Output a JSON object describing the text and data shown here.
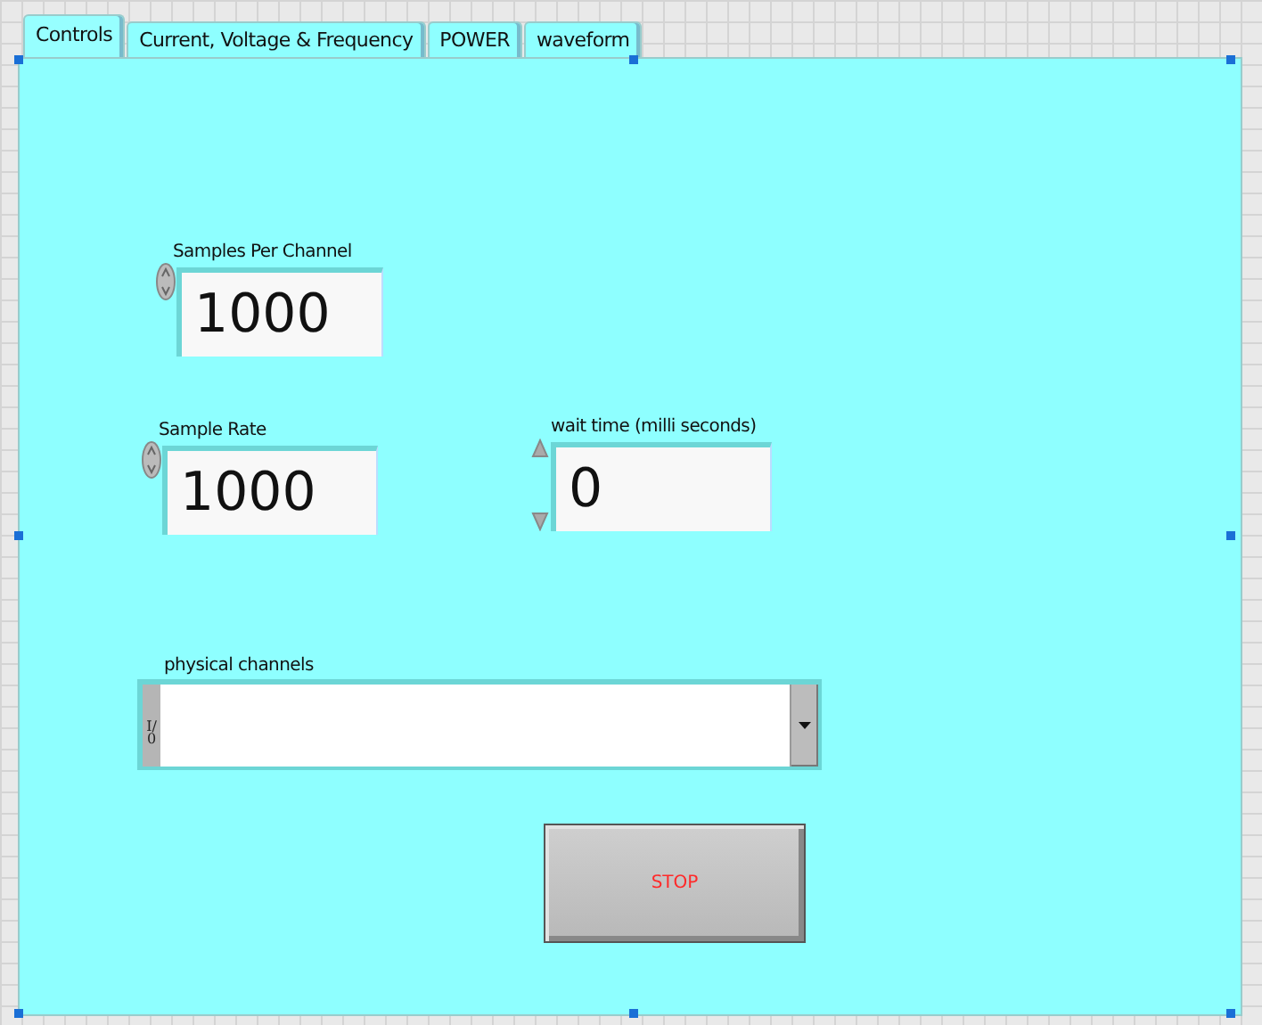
{
  "tabs": [
    {
      "label": "Controls",
      "selected": true
    },
    {
      "label": "Current, Voltage & Frequency",
      "selected": false
    },
    {
      "label": "POWER",
      "selected": false
    },
    {
      "label": "waveform",
      "selected": false
    }
  ],
  "controls": [
    {
      "kind": "numeric",
      "label": "Samples Per Channel",
      "value": "1000",
      "split_arrows": false
    },
    {
      "kind": "numeric",
      "label": "Sample Rate",
      "value": "1000",
      "split_arrows": false
    },
    {
      "kind": "numeric",
      "label": "wait time (milli seconds)",
      "value": "0",
      "split_arrows": true
    },
    {
      "kind": "io",
      "label": "physical channels",
      "io_mark": "I/0"
    },
    {
      "kind": "button",
      "label": "STOP"
    }
  ]
}
